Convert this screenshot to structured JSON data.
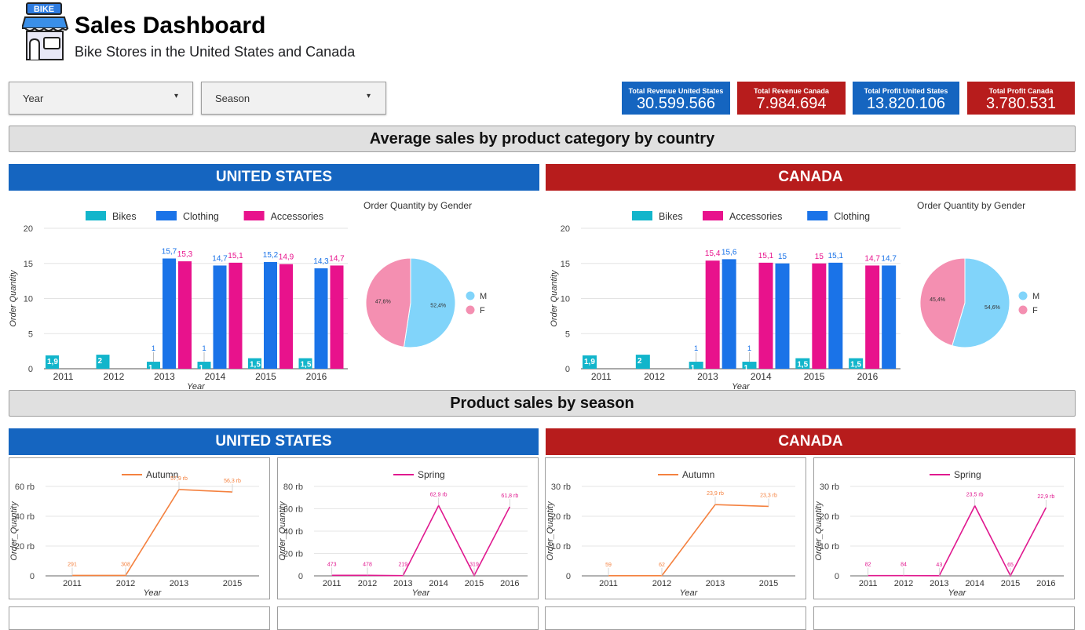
{
  "header": {
    "logo_text": "BIKE",
    "title": "Sales Dashboard",
    "subtitle": "Bike Stores in the United States and Canada"
  },
  "filters": {
    "year_label": "Year",
    "season_label": "Season"
  },
  "kpis": [
    {
      "label": "Total Revenue United States",
      "value": "30.599.566",
      "color": "#1565c0"
    },
    {
      "label": "Total Revenue Canada",
      "value": "7.984.694",
      "color": "#b71c1c"
    },
    {
      "label": "Total Profit United States",
      "value": "13.820.106",
      "color": "#1565c0"
    },
    {
      "label": "Total Profit Canada",
      "value": "3.780.531",
      "color": "#b71c1c"
    }
  ],
  "sections": {
    "avg_sales": "Average sales by product category by country",
    "season_sales": "Product sales by season"
  },
  "countries": {
    "us": "UNITED STATES",
    "ca": "CANADA"
  },
  "chart_data": [
    {
      "id": "us-category",
      "type": "bar",
      "categories": [
        "2011",
        "2012",
        "2013",
        "2014",
        "2015",
        "2016"
      ],
      "xlabel": "Year",
      "ylabel": "Order Quantity",
      "ylim": [
        0,
        20
      ],
      "yticks": [
        0,
        5,
        10,
        15,
        20
      ],
      "series": [
        {
          "name": "Bikes",
          "color": "#12b5cb",
          "values": [
            1.9,
            2,
            1,
            1,
            1.5,
            1.5
          ],
          "labels": [
            "1,9",
            "2",
            "1",
            "1",
            "1,5",
            "1,5"
          ]
        },
        {
          "name": "Clothing",
          "color": "#1a73e8",
          "values": [
            null,
            null,
            15.7,
            14.7,
            15.2,
            14.3
          ],
          "labels": [
            "",
            "",
            "15,7",
            "14,7",
            "15,2",
            "14,3"
          ]
        },
        {
          "name": "Accessories",
          "color": "#e8128c",
          "values": [
            null,
            null,
            15.3,
            15.1,
            14.9,
            14.7
          ],
          "labels": [
            "",
            "",
            "15,3",
            "15,1",
            "14,9",
            "14,7"
          ]
        }
      ]
    },
    {
      "id": "ca-category",
      "type": "bar",
      "categories": [
        "2011",
        "2012",
        "2013",
        "2014",
        "2015",
        "2016"
      ],
      "xlabel": "Year",
      "ylabel": "Order Quantity",
      "ylim": [
        0,
        20
      ],
      "yticks": [
        0,
        5,
        10,
        15,
        20
      ],
      "series": [
        {
          "name": "Bikes",
          "color": "#12b5cb",
          "values": [
            1.9,
            2,
            1,
            1,
            1.5,
            1.5
          ],
          "labels": [
            "1,9",
            "2",
            "1",
            "1",
            "1,5",
            "1,5"
          ]
        },
        {
          "name": "Accessories",
          "color": "#e8128c",
          "values": [
            null,
            null,
            15.4,
            15.1,
            15,
            14.7
          ],
          "labels": [
            "",
            "",
            "15,4",
            "15,1",
            "15",
            "14,7"
          ]
        },
        {
          "name": "Clothing",
          "color": "#1a73e8",
          "values": [
            null,
            null,
            15.6,
            15,
            15.1,
            14.7
          ],
          "labels": [
            "",
            "",
            "15,6",
            "15",
            "15,1",
            "14,7"
          ]
        }
      ]
    },
    {
      "id": "us-gender",
      "type": "pie",
      "title": "Order Quantity by Gender",
      "slices": [
        {
          "name": "M",
          "value": 52.4,
          "label": "52,4%",
          "color": "#81d4fa"
        },
        {
          "name": "F",
          "value": 47.6,
          "label": "47,6%",
          "color": "#f48fb1"
        }
      ]
    },
    {
      "id": "ca-gender",
      "type": "pie",
      "title": "Order Quantity by Gender",
      "slices": [
        {
          "name": "M",
          "value": 54.6,
          "label": "54,6%",
          "color": "#81d4fa"
        },
        {
          "name": "F",
          "value": 45.4,
          "label": "45,4%",
          "color": "#f48fb1"
        }
      ]
    },
    {
      "id": "us-autumn",
      "type": "line",
      "series_name": "Autumn",
      "color": "#f4813f",
      "categories": [
        "2011",
        "2012",
        "2013",
        "2015"
      ],
      "values": [
        291,
        308,
        57900,
        56300
      ],
      "labels": [
        "291",
        "308",
        "57,9 rb",
        "56,3 rb"
      ],
      "ylim": [
        0,
        60000
      ],
      "yticks": [
        0,
        20000,
        40000,
        60000
      ],
      "ytick_labels": [
        "0",
        "20 rb",
        "40 rb",
        "60 rb"
      ],
      "xlabel": "Year",
      "ylabel": "Order_Quantity"
    },
    {
      "id": "us-spring",
      "type": "line",
      "series_name": "Spring",
      "color": "#e0198f",
      "categories": [
        "2011",
        "2012",
        "2013",
        "2014",
        "2015",
        "2016"
      ],
      "values": [
        473,
        478,
        219,
        62900,
        319,
        61800
      ],
      "labels": [
        "473",
        "478",
        "219",
        "62,9 rb",
        "319",
        "61,8 rb"
      ],
      "ylim": [
        0,
        80000
      ],
      "yticks": [
        0,
        20000,
        40000,
        60000,
        80000
      ],
      "ytick_labels": [
        "0",
        "20 rb",
        "40 rb",
        "60 rb",
        "80 rb"
      ],
      "xlabel": "Year",
      "ylabel": "Order_Quantity"
    },
    {
      "id": "ca-autumn",
      "type": "line",
      "series_name": "Autumn",
      "color": "#f4813f",
      "categories": [
        "2011",
        "2012",
        "2013",
        "2015"
      ],
      "values": [
        59,
        62,
        23900,
        23300
      ],
      "labels": [
        "59",
        "62",
        "23,9 rb",
        "23,3 rb"
      ],
      "ylim": [
        0,
        30000
      ],
      "yticks": [
        0,
        10000,
        20000,
        30000
      ],
      "ytick_labels": [
        "0",
        "10 rb",
        "20 rb",
        "30 rb"
      ],
      "xlabel": "Year",
      "ylabel": "Order_Quantity"
    },
    {
      "id": "ca-spring",
      "type": "line",
      "series_name": "Spring",
      "color": "#e0198f",
      "categories": [
        "2011",
        "2012",
        "2013",
        "2014",
        "2015",
        "2016"
      ],
      "values": [
        82,
        84,
        43,
        23500,
        65,
        22900
      ],
      "labels": [
        "82",
        "84",
        "43",
        "23,5 rb",
        "65",
        "22,9 rb"
      ],
      "ylim": [
        0,
        30000
      ],
      "yticks": [
        0,
        10000,
        20000,
        30000
      ],
      "ytick_labels": [
        "0",
        "10 rb",
        "20 rb",
        "30 rb"
      ],
      "xlabel": "Year",
      "ylabel": "Order_Quantity"
    }
  ]
}
